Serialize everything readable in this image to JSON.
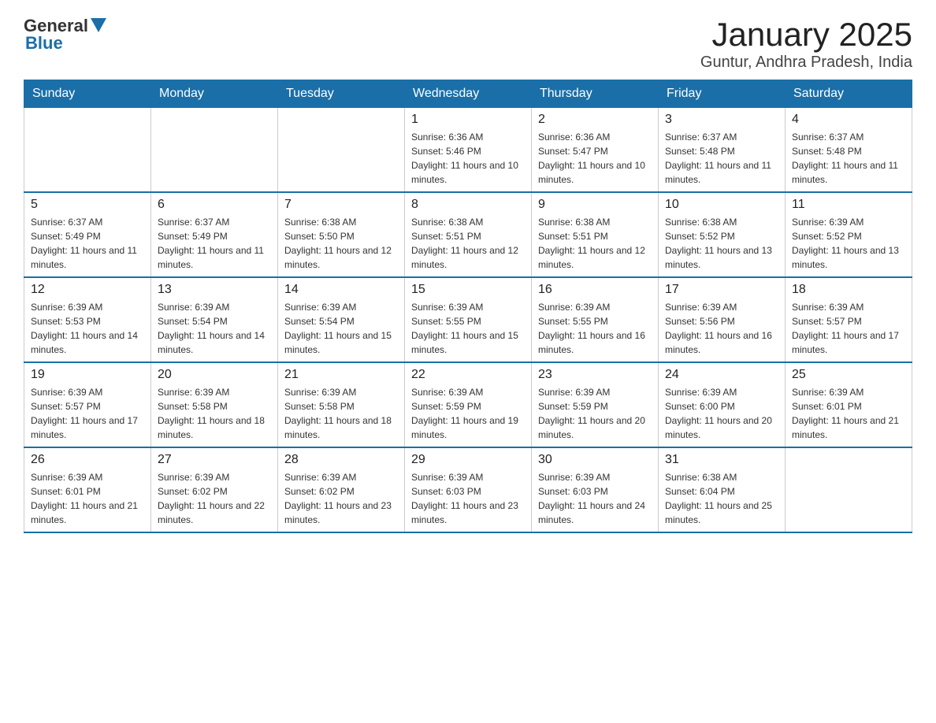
{
  "logo": {
    "general": "General",
    "blue": "Blue"
  },
  "title": "January 2025",
  "subtitle": "Guntur, Andhra Pradesh, India",
  "headers": [
    "Sunday",
    "Monday",
    "Tuesday",
    "Wednesday",
    "Thursday",
    "Friday",
    "Saturday"
  ],
  "weeks": [
    [
      {
        "day": "",
        "info": ""
      },
      {
        "day": "",
        "info": ""
      },
      {
        "day": "",
        "info": ""
      },
      {
        "day": "1",
        "info": "Sunrise: 6:36 AM\nSunset: 5:46 PM\nDaylight: 11 hours and 10 minutes."
      },
      {
        "day": "2",
        "info": "Sunrise: 6:36 AM\nSunset: 5:47 PM\nDaylight: 11 hours and 10 minutes."
      },
      {
        "day": "3",
        "info": "Sunrise: 6:37 AM\nSunset: 5:48 PM\nDaylight: 11 hours and 11 minutes."
      },
      {
        "day": "4",
        "info": "Sunrise: 6:37 AM\nSunset: 5:48 PM\nDaylight: 11 hours and 11 minutes."
      }
    ],
    [
      {
        "day": "5",
        "info": "Sunrise: 6:37 AM\nSunset: 5:49 PM\nDaylight: 11 hours and 11 minutes."
      },
      {
        "day": "6",
        "info": "Sunrise: 6:37 AM\nSunset: 5:49 PM\nDaylight: 11 hours and 11 minutes."
      },
      {
        "day": "7",
        "info": "Sunrise: 6:38 AM\nSunset: 5:50 PM\nDaylight: 11 hours and 12 minutes."
      },
      {
        "day": "8",
        "info": "Sunrise: 6:38 AM\nSunset: 5:51 PM\nDaylight: 11 hours and 12 minutes."
      },
      {
        "day": "9",
        "info": "Sunrise: 6:38 AM\nSunset: 5:51 PM\nDaylight: 11 hours and 12 minutes."
      },
      {
        "day": "10",
        "info": "Sunrise: 6:38 AM\nSunset: 5:52 PM\nDaylight: 11 hours and 13 minutes."
      },
      {
        "day": "11",
        "info": "Sunrise: 6:39 AM\nSunset: 5:52 PM\nDaylight: 11 hours and 13 minutes."
      }
    ],
    [
      {
        "day": "12",
        "info": "Sunrise: 6:39 AM\nSunset: 5:53 PM\nDaylight: 11 hours and 14 minutes."
      },
      {
        "day": "13",
        "info": "Sunrise: 6:39 AM\nSunset: 5:54 PM\nDaylight: 11 hours and 14 minutes."
      },
      {
        "day": "14",
        "info": "Sunrise: 6:39 AM\nSunset: 5:54 PM\nDaylight: 11 hours and 15 minutes."
      },
      {
        "day": "15",
        "info": "Sunrise: 6:39 AM\nSunset: 5:55 PM\nDaylight: 11 hours and 15 minutes."
      },
      {
        "day": "16",
        "info": "Sunrise: 6:39 AM\nSunset: 5:55 PM\nDaylight: 11 hours and 16 minutes."
      },
      {
        "day": "17",
        "info": "Sunrise: 6:39 AM\nSunset: 5:56 PM\nDaylight: 11 hours and 16 minutes."
      },
      {
        "day": "18",
        "info": "Sunrise: 6:39 AM\nSunset: 5:57 PM\nDaylight: 11 hours and 17 minutes."
      }
    ],
    [
      {
        "day": "19",
        "info": "Sunrise: 6:39 AM\nSunset: 5:57 PM\nDaylight: 11 hours and 17 minutes."
      },
      {
        "day": "20",
        "info": "Sunrise: 6:39 AM\nSunset: 5:58 PM\nDaylight: 11 hours and 18 minutes."
      },
      {
        "day": "21",
        "info": "Sunrise: 6:39 AM\nSunset: 5:58 PM\nDaylight: 11 hours and 18 minutes."
      },
      {
        "day": "22",
        "info": "Sunrise: 6:39 AM\nSunset: 5:59 PM\nDaylight: 11 hours and 19 minutes."
      },
      {
        "day": "23",
        "info": "Sunrise: 6:39 AM\nSunset: 5:59 PM\nDaylight: 11 hours and 20 minutes."
      },
      {
        "day": "24",
        "info": "Sunrise: 6:39 AM\nSunset: 6:00 PM\nDaylight: 11 hours and 20 minutes."
      },
      {
        "day": "25",
        "info": "Sunrise: 6:39 AM\nSunset: 6:01 PM\nDaylight: 11 hours and 21 minutes."
      }
    ],
    [
      {
        "day": "26",
        "info": "Sunrise: 6:39 AM\nSunset: 6:01 PM\nDaylight: 11 hours and 21 minutes."
      },
      {
        "day": "27",
        "info": "Sunrise: 6:39 AM\nSunset: 6:02 PM\nDaylight: 11 hours and 22 minutes."
      },
      {
        "day": "28",
        "info": "Sunrise: 6:39 AM\nSunset: 6:02 PM\nDaylight: 11 hours and 23 minutes."
      },
      {
        "day": "29",
        "info": "Sunrise: 6:39 AM\nSunset: 6:03 PM\nDaylight: 11 hours and 23 minutes."
      },
      {
        "day": "30",
        "info": "Sunrise: 6:39 AM\nSunset: 6:03 PM\nDaylight: 11 hours and 24 minutes."
      },
      {
        "day": "31",
        "info": "Sunrise: 6:38 AM\nSunset: 6:04 PM\nDaylight: 11 hours and 25 minutes."
      },
      {
        "day": "",
        "info": ""
      }
    ]
  ]
}
